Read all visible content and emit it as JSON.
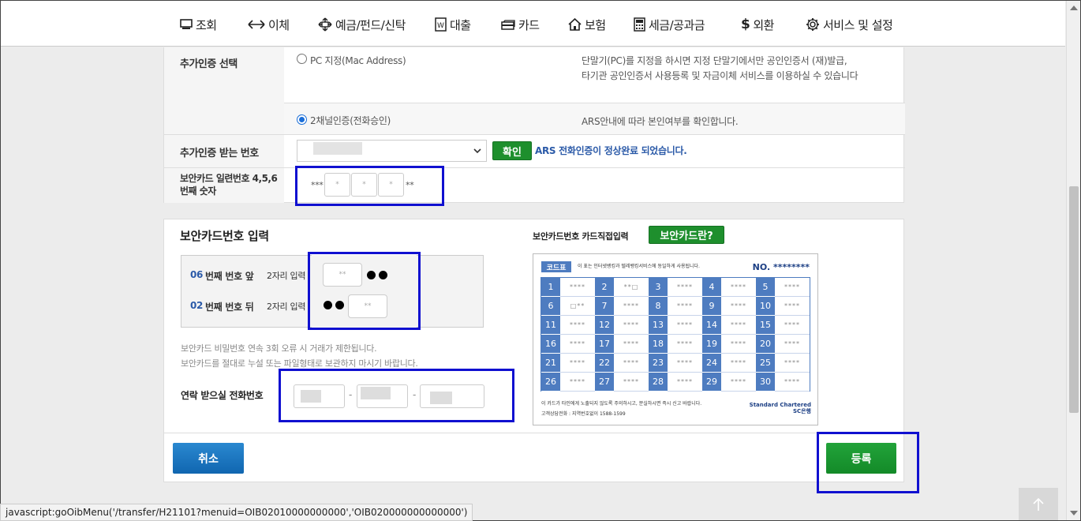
{
  "nav": {
    "items": [
      {
        "label": "조회",
        "icon": "monitor-icon"
      },
      {
        "label": "이체",
        "icon": "transfer-arrows-icon"
      },
      {
        "label": "예금/펀드/신탁",
        "icon": "move-cross-icon"
      },
      {
        "label": "대출",
        "icon": "document-won-icon"
      },
      {
        "label": "카드",
        "icon": "card-icon"
      },
      {
        "label": "보험",
        "icon": "house-icon"
      },
      {
        "label": "세금/공과금",
        "icon": "calculator-icon"
      },
      {
        "label": "외환",
        "icon": "dollar-icon"
      },
      {
        "label": "서비스 및 설정",
        "icon": "gear-icon"
      }
    ]
  },
  "auth": {
    "additional_auth_label": "추가인증 선택",
    "option_pc_label": "PC 지정(Mac Address)",
    "option_pc_desc_line1": "단말기(PC)를 지정을 하시면 지정 단말기에서만 공인인증서 (재)발급,",
    "option_pc_desc_line2": "타기관 공인인증서 사용등록 및 자금이체 서비스를 이용하실 수 있습니다",
    "option_2ch_label": "2채널인증(전화승인)",
    "option_2ch_desc": "ARS안내에 따라 본인여부를 확인합니다.",
    "receive_number_label": "추가인증 받는 번호",
    "confirm_button": "확인",
    "ars_status": "ARS 전화인증이 정상완료 되었습니다.",
    "serial_label_line1": "보안카드 일련번호 4,5,6",
    "serial_label_line2": "번째 숫자",
    "serial_prefix": "***",
    "serial_suffix": "**",
    "serial_inputs": [
      "*",
      "*",
      "*"
    ]
  },
  "security_card": {
    "title": "보안카드번호 입력",
    "direct_input_label": "보안카드번호 카드직접입력",
    "what_is_button": "보안카드란?",
    "row1_num": "06",
    "row1_text": "번째 번호 앞",
    "row1_hint": "2자리 입력",
    "row2_num": "02",
    "row2_text": "번째 번호 뒤",
    "row2_hint": "2자리 입력",
    "input_placeholder": "**",
    "warning_line1": "보안카드 비밀번호 연속 3회 오류 시 거래가 제한됩니다.",
    "warning_line2": "보안카드를 절대로 누설 또는 파일형태로 보관하지 마시기 바랍니다.",
    "phone_label": "연락 받으실 전화번호",
    "phone_sep": "-"
  },
  "code_card": {
    "badge": "코드표",
    "head_text": "이 표는 인터넷뱅킹과 텔레뱅킹서비스에 동일하게 사용됩니다.",
    "no_label": "NO. ********",
    "cells": [
      {
        "n": "1",
        "v": "****"
      },
      {
        "n": "2",
        "v": "**□"
      },
      {
        "n": "3",
        "v": "****"
      },
      {
        "n": "4",
        "v": "****"
      },
      {
        "n": "5",
        "v": "****"
      },
      {
        "n": "6",
        "v": "□**"
      },
      {
        "n": "7",
        "v": "****"
      },
      {
        "n": "8",
        "v": "****"
      },
      {
        "n": "9",
        "v": "****"
      },
      {
        "n": "10",
        "v": "****"
      },
      {
        "n": "11",
        "v": "****"
      },
      {
        "n": "12",
        "v": "****"
      },
      {
        "n": "13",
        "v": "****"
      },
      {
        "n": "14",
        "v": "****"
      },
      {
        "n": "15",
        "v": "****"
      },
      {
        "n": "16",
        "v": "****"
      },
      {
        "n": "17",
        "v": "****"
      },
      {
        "n": "18",
        "v": "****"
      },
      {
        "n": "19",
        "v": "****"
      },
      {
        "n": "20",
        "v": "****"
      },
      {
        "n": "21",
        "v": "****"
      },
      {
        "n": "22",
        "v": "****"
      },
      {
        "n": "23",
        "v": "****"
      },
      {
        "n": "24",
        "v": "****"
      },
      {
        "n": "25",
        "v": "****"
      },
      {
        "n": "26",
        "v": "****"
      },
      {
        "n": "27",
        "v": "****"
      },
      {
        "n": "28",
        "v": "****"
      },
      {
        "n": "29",
        "v": "****"
      },
      {
        "n": "30",
        "v": "****"
      }
    ],
    "foot_line1": "이 카드가 타인에게 노출되지 않도록 주의하시고, 분실하시면 즉시 신고 바랍니다.",
    "foot_line2": "고객상담전화 : 지역번호없이 1588-1599",
    "logo_line1": "Standard Chartered",
    "logo_line2": "SC은행"
  },
  "buttons": {
    "cancel": "취소",
    "register": "등록"
  },
  "statusbar": {
    "text": "javascript:goOibMenu('/transfer/H21101?menuid=OIB02010000000000','OIB020000000000000')"
  },
  "colors": {
    "highlight": "#1010d0",
    "green": "#1e8f2d",
    "blue": "#1a6ed8",
    "card_blue": "#4e7cc0"
  }
}
